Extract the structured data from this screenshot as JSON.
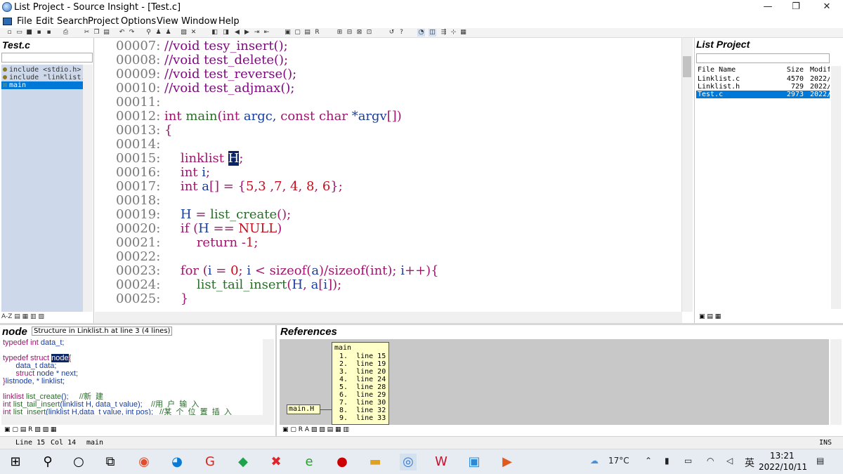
{
  "window": {
    "title": "List Project - Source Insight - [Test.c]",
    "controls": [
      "—",
      "❐",
      "✕"
    ]
  },
  "menu": [
    "File",
    "Edit",
    "Search",
    "Project",
    "Options",
    "View",
    "Window",
    "Help"
  ],
  "mdi_controls": "‒  ▫  ✕",
  "symbol_pane": {
    "title": "Test.c",
    "items": [
      "include <stdio.h>",
      "include \"linklist.",
      "main"
    ],
    "selected_index": 2,
    "tools": "A-Z ▤ ▦ ▥ ▧"
  },
  "editor": {
    "lines": [
      {
        "num": "00007:",
        "parts": [
          {
            "t": "//void tesy_insert();",
            "c": "cm"
          }
        ]
      },
      {
        "num": "00008:",
        "parts": [
          {
            "t": "//void test_delete();",
            "c": "cm"
          }
        ]
      },
      {
        "num": "00009:",
        "parts": [
          {
            "t": "//void test_reverse();",
            "c": "cm"
          }
        ]
      },
      {
        "num": "00010:",
        "parts": [
          {
            "t": "//void test_adjmax();",
            "c": "cm"
          }
        ]
      },
      {
        "num": "00011:",
        "parts": []
      },
      {
        "num": "00012:",
        "parts": [
          {
            "t": "int ",
            "c": "kw"
          },
          {
            "t": "main",
            "c": "fn"
          },
          {
            "t": "(",
            "c": "pu"
          },
          {
            "t": "int ",
            "c": "kw"
          },
          {
            "t": "argc, ",
            "c": "id"
          },
          {
            "t": "const char ",
            "c": "kw"
          },
          {
            "t": "*argv",
            "c": "id"
          },
          {
            "t": "[])",
            "c": "pu"
          }
        ]
      },
      {
        "num": "00013:",
        "parts": [
          {
            "t": "{",
            "c": "pu"
          }
        ]
      },
      {
        "num": "00014:",
        "parts": []
      },
      {
        "num": "00015:",
        "parts": [
          {
            "t": "    linklist ",
            "c": "kw"
          },
          {
            "t": "H",
            "c": "cur"
          },
          {
            "t": ";",
            "c": "pu"
          }
        ]
      },
      {
        "num": "00016:",
        "parts": [
          {
            "t": "    int ",
            "c": "kw"
          },
          {
            "t": "i",
            "c": "id"
          },
          {
            "t": ";",
            "c": "pu"
          }
        ]
      },
      {
        "num": "00017:",
        "parts": [
          {
            "t": "    int ",
            "c": "kw"
          },
          {
            "t": "a",
            "c": "id"
          },
          {
            "t": "[] = {",
            "c": "pu"
          },
          {
            "t": "5",
            "c": "nm"
          },
          {
            "t": ",",
            "c": "pu"
          },
          {
            "t": "3 ",
            "c": "nm"
          },
          {
            "t": ",",
            "c": "pu"
          },
          {
            "t": "7",
            "c": "nm"
          },
          {
            "t": ", ",
            "c": "pu"
          },
          {
            "t": "4",
            "c": "nm"
          },
          {
            "t": ", ",
            "c": "pu"
          },
          {
            "t": "8",
            "c": "nm"
          },
          {
            "t": ", ",
            "c": "pu"
          },
          {
            "t": "6",
            "c": "nm"
          },
          {
            "t": "};",
            "c": "pu"
          }
        ]
      },
      {
        "num": "00018:",
        "parts": []
      },
      {
        "num": "00019:",
        "parts": [
          {
            "t": "    H ",
            "c": "id"
          },
          {
            "t": "= ",
            "c": "pu"
          },
          {
            "t": "list_create",
            "c": "fn"
          },
          {
            "t": "();",
            "c": "pu"
          }
        ]
      },
      {
        "num": "00020:",
        "parts": [
          {
            "t": "    if ",
            "c": "kw"
          },
          {
            "t": "(",
            "c": "pu"
          },
          {
            "t": "H ",
            "c": "id"
          },
          {
            "t": "== ",
            "c": "pu"
          },
          {
            "t": "NULL",
            "c": "nm"
          },
          {
            "t": ")",
            "c": "pu"
          }
        ]
      },
      {
        "num": "00021:",
        "parts": [
          {
            "t": "        return ",
            "c": "kw"
          },
          {
            "t": "-",
            "c": "pu"
          },
          {
            "t": "1",
            "c": "nm"
          },
          {
            "t": ";",
            "c": "pu"
          }
        ]
      },
      {
        "num": "00022:",
        "parts": []
      },
      {
        "num": "00023:",
        "parts": [
          {
            "t": "    for ",
            "c": "kw"
          },
          {
            "t": "(",
            "c": "pu"
          },
          {
            "t": "i ",
            "c": "id"
          },
          {
            "t": "= ",
            "c": "pu"
          },
          {
            "t": "0",
            "c": "nm"
          },
          {
            "t": "; ",
            "c": "pu"
          },
          {
            "t": "i ",
            "c": "id"
          },
          {
            "t": "< ",
            "c": "pu"
          },
          {
            "t": "sizeof",
            "c": "kw"
          },
          {
            "t": "(",
            "c": "pu"
          },
          {
            "t": "a",
            "c": "id"
          },
          {
            "t": ")/",
            "c": "pu"
          },
          {
            "t": "sizeof",
            "c": "kw"
          },
          {
            "t": "(",
            "c": "pu"
          },
          {
            "t": "int",
            "c": "kw"
          },
          {
            "t": "); ",
            "c": "pu"
          },
          {
            "t": "i",
            "c": "id"
          },
          {
            "t": "++){",
            "c": "pu"
          }
        ]
      },
      {
        "num": "00024:",
        "parts": [
          {
            "t": "        list_tail_insert",
            "c": "fn"
          },
          {
            "t": "(",
            "c": "pu"
          },
          {
            "t": "H",
            "c": "id"
          },
          {
            "t": ", ",
            "c": "pu"
          },
          {
            "t": "a",
            "c": "id"
          },
          {
            "t": "[",
            "c": "pu"
          },
          {
            "t": "i",
            "c": "id"
          },
          {
            "t": "]);",
            "c": "pu"
          }
        ]
      },
      {
        "num": "00025:",
        "parts": [
          {
            "t": "    }",
            "c": "pu"
          }
        ]
      }
    ]
  },
  "project_pane": {
    "title": "List Project",
    "columns": [
      "File Name",
      "Size",
      "Modif"
    ],
    "rows": [
      [
        "Linklist.c",
        "4570",
        "2022/"
      ],
      [
        "Linklist.h",
        "729",
        "2022/"
      ],
      [
        "Test.c",
        "2973",
        "2022/"
      ]
    ],
    "selected_index": 2
  },
  "context_pane": {
    "title": "node",
    "info": "Structure in Linklist.h at line 3 (4 lines)",
    "code": [
      [
        {
          "t": "typedef int ",
          "c": "c-kw"
        },
        {
          "t": "data_t;",
          "c": "c-id"
        }
      ],
      [],
      [
        {
          "t": "typedef struct ",
          "c": "c-kw"
        },
        {
          "t": "node",
          "c": "c-hl"
        },
        {
          "t": "{",
          "c": "c-kw"
        }
      ],
      [
        {
          "t": "      data_t data;",
          "c": "c-id"
        }
      ],
      [
        {
          "t": "      struct ",
          "c": "c-kw"
        },
        {
          "t": "node",
          "c": "c-id"
        },
        {
          "t": " * next;",
          "c": "c-id"
        }
      ],
      [
        {
          "t": "}",
          "c": "c-kw"
        },
        {
          "t": "listnode, * linklist;",
          "c": "c-id"
        }
      ],
      [],
      [
        {
          "t": "linklist ",
          "c": "c-kw"
        },
        {
          "t": "list_create",
          "c": "c-fn"
        },
        {
          "t": "();     ",
          "c": "c-id"
        },
        {
          "t": "//新  建",
          "c": "c-cm"
        }
      ],
      [
        {
          "t": "int ",
          "c": "c-kw"
        },
        {
          "t": "list_tail_insert",
          "c": "c-fn"
        },
        {
          "t": "(linklist H, data_t value);    ",
          "c": "c-id"
        },
        {
          "t": "//用  户  输  入",
          "c": "c-cm"
        }
      ],
      [
        {
          "t": "int ",
          "c": "c-kw"
        },
        {
          "t": "list_insert",
          "c": "c-fn"
        },
        {
          "t": "(linklist H,data_t value, int pos);   ",
          "c": "c-id"
        },
        {
          "t": "//某  个  位  置  插  入",
          "c": "c-cm"
        }
      ]
    ]
  },
  "references_pane": {
    "title": "References",
    "node_label": "main.H",
    "box_title": "main",
    "lines": [
      "1.  line 15",
      "2.  line 19",
      "3.  line 20",
      "4.  line 24",
      "5.  line 28",
      "6.  line 29",
      "7.  line 30",
      "8.  line 32",
      "9.  line 33"
    ]
  },
  "status": {
    "line": "Line 15",
    "col": "Col 14",
    "func": "main",
    "mode": "INS"
  },
  "taskbar": {
    "temperature": "17°C",
    "lang": "英",
    "time": "13:21",
    "date": "2022/10/11"
  }
}
